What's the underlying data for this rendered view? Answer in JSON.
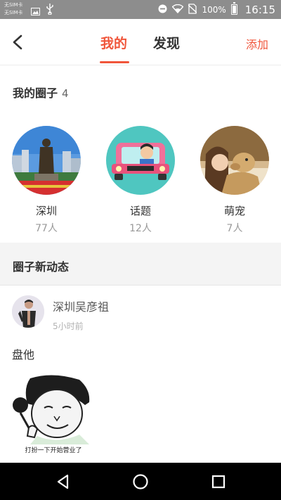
{
  "status_bar": {
    "sim1": "无SIM卡",
    "sim2": "无SIM卡",
    "battery": "100%",
    "time": "16:15",
    "icons": [
      "image-icon",
      "usb-icon",
      "minus-circle-icon",
      "wifi-icon",
      "no-sim-icon",
      "battery-icon"
    ]
  },
  "top_nav": {
    "tabs": [
      {
        "label": "我的",
        "active": true
      },
      {
        "label": "发现",
        "active": false
      }
    ],
    "add_label": "添加",
    "accent_color": "#f0553a"
  },
  "my_circles": {
    "title": "我的圈子",
    "count": "4",
    "items": [
      {
        "name": "深圳",
        "members": "77人"
      },
      {
        "name": "话题",
        "members": "12人"
      },
      {
        "name": "萌宠",
        "members": "7人"
      }
    ]
  },
  "feed": {
    "title": "圈子新动态",
    "post": {
      "user": "深圳吴彦祖",
      "time": "5小时前",
      "text": "盘他",
      "image_caption": "打扮一下开始营业了"
    }
  },
  "nav_bar": {
    "icons": [
      "back-triangle-icon",
      "home-circle-icon",
      "recents-square-icon"
    ]
  }
}
